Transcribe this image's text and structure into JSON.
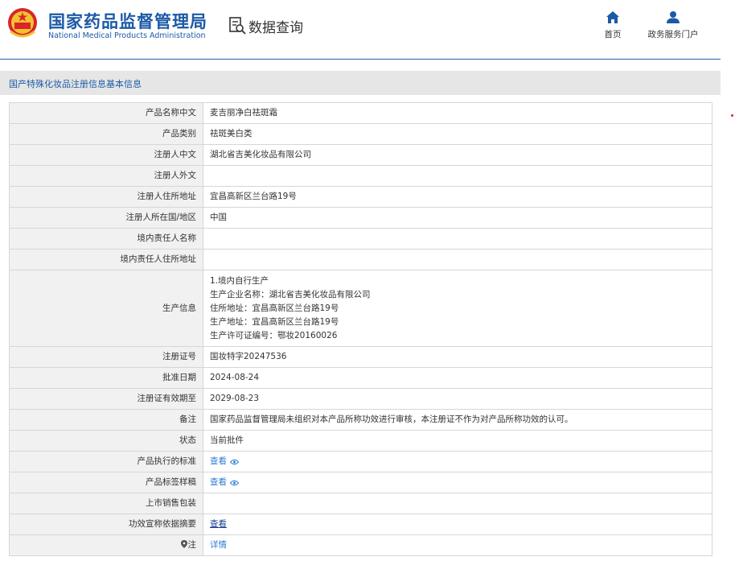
{
  "header": {
    "org_cn": "国家药品监督管理局",
    "org_en": "National Medical Products Administration",
    "query_label": "数据查询",
    "nav": [
      {
        "label": "首页",
        "icon": "home-icon"
      },
      {
        "label": "政务服务门户",
        "icon": "user-icon"
      }
    ]
  },
  "section_title": "国产特殊化妆品注册信息基本信息",
  "colors": {
    "brand": "#1b5aa6",
    "link": "#2f7bd1",
    "label_bg": "#f1f1f1",
    "section_bg": "#e6e6e6"
  },
  "rows": {
    "name_cn": {
      "label": "产品名称中文",
      "value": "麦吉丽净白祛斑霜"
    },
    "category": {
      "label": "产品类别",
      "value": "祛斑美白类"
    },
    "registrant_cn": {
      "label": "注册人中文",
      "value": "湖北省吉美化妆品有限公司"
    },
    "registrant_en": {
      "label": "注册人外文",
      "value": ""
    },
    "registrant_addr": {
      "label": "注册人住所地址",
      "value": "宜昌高新区兰台路19号"
    },
    "registrant_country": {
      "label": "注册人所在国/地区",
      "value": "中国"
    },
    "domestic_agent": {
      "label": "境内责任人名称",
      "value": ""
    },
    "domestic_agent_addr": {
      "label": "境内责任人住所地址",
      "value": ""
    },
    "production": {
      "label": "生产信息",
      "lines": [
        "1.境内自行生产",
        "生产企业名称：湖北省吉美化妆品有限公司",
        "住所地址：宜昌高新区兰台路19号",
        "生产地址：宜昌高新区兰台路19号",
        "生产许可证编号：鄂妆20160026"
      ]
    },
    "reg_no": {
      "label": "注册证号",
      "value": "国妆特字20247536"
    },
    "approve_date": {
      "label": "批准日期",
      "value": "2024-08-24"
    },
    "valid_until": {
      "label": "注册证有效期至",
      "value": "2029-08-23"
    },
    "remark": {
      "label": "备注",
      "value": "国家药品监督管理局未组织对本产品所称功效进行审核，本注册证不作为对产品所称功效的认可。"
    },
    "status": {
      "label": "状态",
      "value": "当前批件"
    },
    "standard": {
      "label": "产品执行的标准",
      "link": "查看"
    },
    "label_sample": {
      "label": "产品标签样稿",
      "link": "查看"
    },
    "packaging": {
      "label": "上市销售包装",
      "value": ""
    },
    "efficacy": {
      "label": "功效宣称依据摘要",
      "link": "查看"
    },
    "note": {
      "label": "注",
      "link": "详情"
    }
  }
}
